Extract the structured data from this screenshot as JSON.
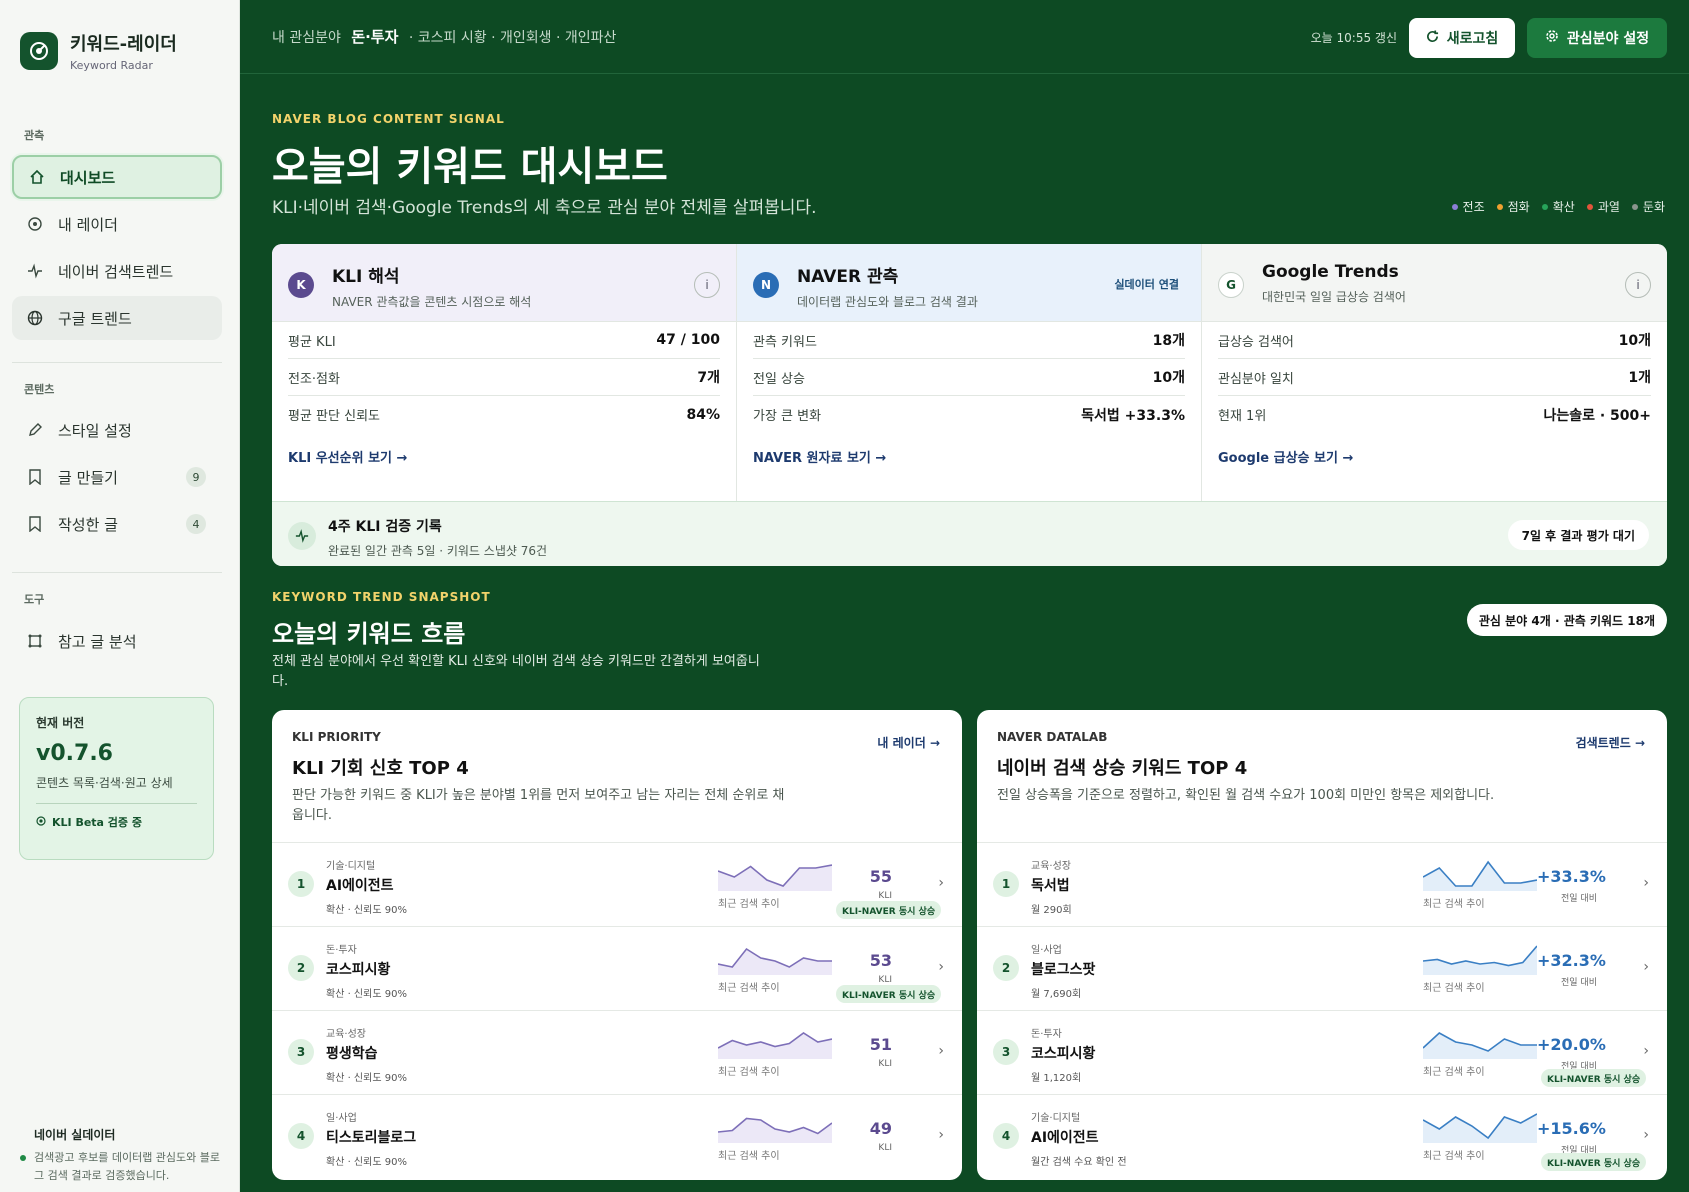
{
  "sidebar": {
    "brand_title": "키워드-레이더",
    "brand_sub": "Keyword Radar",
    "sections": {
      "observe": "관측",
      "content": "콘텐츠",
      "tools": "도구"
    },
    "items": [
      {
        "label": "대시보드",
        "icon": "home-icon"
      },
      {
        "label": "내 레이더",
        "icon": "radar-icon"
      },
      {
        "label": "네이버 검색트렌드",
        "icon": "pulse-icon"
      },
      {
        "label": "구글 트렌드",
        "icon": "globe-icon"
      },
      {
        "label": "스타일 설정",
        "icon": "pencil-icon"
      },
      {
        "label": "글 만들기",
        "icon": "bookmark-icon",
        "badge": "9"
      },
      {
        "label": "작성한 글",
        "icon": "bookmark-icon",
        "badge": "4"
      },
      {
        "label": "참고 글 분석",
        "icon": "crop-icon"
      }
    ],
    "version": {
      "label": "현재 버전",
      "value": "v0.7.6",
      "desc": "콘텐츠 목록·검색·원고 상세",
      "beta": "KLI Beta 검증 중"
    },
    "realtime": {
      "title": "네이버 실데이터",
      "desc": "검색광고 후보를 데이터랩 관심도와 블로그 검색 결과로 검증했습니다."
    }
  },
  "topbar": {
    "crumb_prefix": "내 관심분야",
    "crumb_main": "돈·투자",
    "crumb_rest": "· 코스피 시황 · 개인회생 · 개인파산",
    "updated": "오늘 10:55 갱신",
    "refresh": "새로고침",
    "interest": "관심분야 설정"
  },
  "hero": {
    "eyebrow": "NAVER BLOG CONTENT SIGNAL",
    "title": "오늘의 키워드 대시보드",
    "desc": "KLI·네이버 검색·Google Trends의 세 축으로 관심 분야 전체를 살펴봅니다.",
    "legend": [
      {
        "label": "전조",
        "color": "#8b7fd6"
      },
      {
        "label": "점화",
        "color": "#f0a030"
      },
      {
        "label": "확산",
        "color": "#27a35a"
      },
      {
        "label": "과열",
        "color": "#e2553b"
      },
      {
        "label": "둔화",
        "color": "#8a958d"
      }
    ]
  },
  "panels": {
    "kli": {
      "badge": "K",
      "title": "KLI 해석",
      "sub": "NAVER 관측값을 콘텐츠 시점으로 해석",
      "rows": [
        {
          "label": "평균 KLI",
          "value": "47 / 100"
        },
        {
          "label": "전조·점화",
          "value": "7개"
        },
        {
          "label": "평균 판단 신뢰도",
          "value": "84%"
        }
      ],
      "link": "KLI 우선순위 보기 →"
    },
    "naver": {
      "badge": "N",
      "title": "NAVER 관측",
      "sub": "데이터랩 관심도와 블로그 검색 결과",
      "live": "실데이터 연결",
      "rows": [
        {
          "label": "관측 키워드",
          "value": "18개"
        },
        {
          "label": "전일 상승",
          "value": "10개"
        },
        {
          "label": "가장 큰 변화",
          "value": "독서법 +33.3%"
        }
      ],
      "link": "NAVER 원자료 보기 →"
    },
    "google": {
      "badge": "G",
      "title": "Google Trends",
      "sub": "대한민국 일일 급상승 검색어",
      "rows": [
        {
          "label": "급상승 검색어",
          "value": "10개"
        },
        {
          "label": "관심분야 일치",
          "value": "1개"
        },
        {
          "label": "현재 1위",
          "value": "나는솔로 · 500+"
        }
      ],
      "link": "Google 급상승 보기 →"
    },
    "footer": {
      "title": "4주 KLI 검증 기록",
      "sub": "완료된 일간 관측 5일 · 키워드 스냅샷 76건",
      "pill": "7일 후 결과 평가 대기"
    }
  },
  "snapshot": {
    "eyebrow": "KEYWORD TREND SNAPSHOT",
    "title": "오늘의 키워드 흐름",
    "desc": "전체 관심 분야에서 우선 확인할 KLI 신호와 네이버 검색 상승 키워드만 간결하게 보여줍니다.",
    "pill": "관심 분야 4개 · 관측 키워드 18개"
  },
  "kli_card": {
    "eyebrow": "KLI PRIORITY",
    "title": "KLI 기회 신호 TOP 4",
    "desc": "판단 가능한 키워드 중 KLI가 높은 분야별 1위를 먼저 보여주고 남는 자리는 전체 순위로 채웁니다.",
    "link": "내 레이더 →",
    "caption": "최근 검색 추이",
    "rows": [
      {
        "rank": "1",
        "cat": "기술·디지털",
        "name": "AI에이전트",
        "meta": "확산 · 신뢰도 90%",
        "score": "55",
        "unit": "KLI",
        "tag": "KLI-NAVER 동시 상승",
        "trend": [
          0.6,
          0.4,
          0.75,
          0.3,
          0.1,
          0.7,
          0.7,
          0.8
        ]
      },
      {
        "rank": "2",
        "cat": "돈·투자",
        "name": "코스피시황",
        "meta": "확산 · 신뢰도 90%",
        "score": "53",
        "unit": "KLI",
        "tag": "KLI-NAVER 동시 상승",
        "trend": [
          0.3,
          0.2,
          0.8,
          0.5,
          0.4,
          0.2,
          0.5,
          0.4,
          0.4
        ]
      },
      {
        "rank": "3",
        "cat": "교육·성장",
        "name": "평생학습",
        "meta": "확산 · 신뢰도 90%",
        "score": "51",
        "unit": "KLI",
        "tag": "",
        "trend": [
          0.3,
          0.55,
          0.4,
          0.5,
          0.35,
          0.45,
          0.8,
          0.5,
          0.6
        ]
      },
      {
        "rank": "4",
        "cat": "일·사업",
        "name": "티스토리블로그",
        "meta": "확산 · 신뢰도 90%",
        "score": "49",
        "unit": "KLI",
        "tag": "",
        "trend": [
          0.3,
          0.35,
          0.75,
          0.7,
          0.4,
          0.3,
          0.45,
          0.25,
          0.6
        ]
      }
    ]
  },
  "naver_card": {
    "eyebrow": "NAVER DATALAB",
    "title": "네이버 검색 상승 키워드 TOP 4",
    "desc": "전일 상승폭을 기준으로 정렬하고, 확인된 월 검색 수요가 100회 미만인 항목은 제외합니다.",
    "link": "검색트렌드 →",
    "caption": "최근 검색 추이",
    "rows": [
      {
        "rank": "1",
        "cat": "교육·성장",
        "name": "독서법",
        "meta": "월 290회",
        "score": "+33.3%",
        "unit": "전일 대비",
        "tag": "",
        "trend": [
          0.4,
          0.7,
          0.1,
          0.1,
          0.9,
          0.2,
          0.2,
          0.3
        ]
      },
      {
        "rank": "2",
        "cat": "일·사업",
        "name": "블로그스팟",
        "meta": "월 7,690회",
        "score": "+32.3%",
        "unit": "전일 대비",
        "tag": "",
        "trend": [
          0.4,
          0.45,
          0.3,
          0.4,
          0.3,
          0.35,
          0.25,
          0.35,
          0.9
        ]
      },
      {
        "rank": "3",
        "cat": "돈·투자",
        "name": "코스피시황",
        "meta": "월 1,120회",
        "score": "+20.0%",
        "unit": "전일 대비",
        "tag": "KLI-NAVER 동시 상승",
        "trend": [
          0.3,
          0.8,
          0.5,
          0.4,
          0.2,
          0.6,
          0.4,
          0.4
        ]
      },
      {
        "rank": "4",
        "cat": "기술·디지털",
        "name": "AI에이전트",
        "meta": "월간 검색 수요 확인 전",
        "score": "+15.6%",
        "unit": "전일 대비",
        "tag": "KLI-NAVER 동시 상승",
        "trend": [
          0.7,
          0.4,
          0.8,
          0.5,
          0.1,
          0.8,
          0.6,
          0.9
        ]
      }
    ]
  }
}
